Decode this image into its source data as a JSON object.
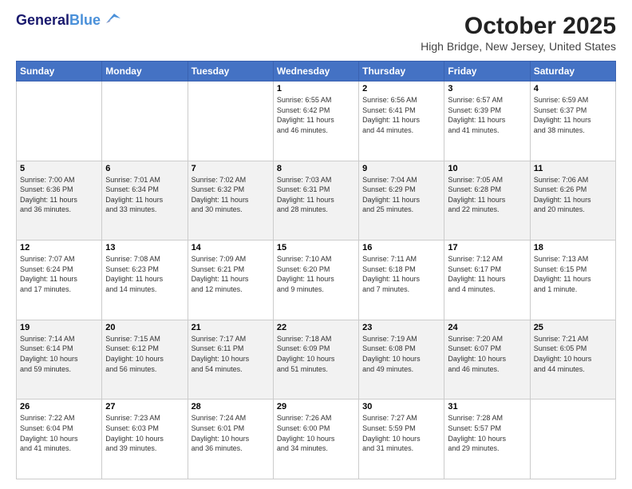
{
  "logo": {
    "line1": "General",
    "line2": "Blue"
  },
  "title": "October 2025",
  "subtitle": "High Bridge, New Jersey, United States",
  "days_of_week": [
    "Sunday",
    "Monday",
    "Tuesday",
    "Wednesday",
    "Thursday",
    "Friday",
    "Saturday"
  ],
  "weeks": [
    [
      {
        "day": "",
        "info": ""
      },
      {
        "day": "",
        "info": ""
      },
      {
        "day": "",
        "info": ""
      },
      {
        "day": "1",
        "info": "Sunrise: 6:55 AM\nSunset: 6:42 PM\nDaylight: 11 hours\nand 46 minutes."
      },
      {
        "day": "2",
        "info": "Sunrise: 6:56 AM\nSunset: 6:41 PM\nDaylight: 11 hours\nand 44 minutes."
      },
      {
        "day": "3",
        "info": "Sunrise: 6:57 AM\nSunset: 6:39 PM\nDaylight: 11 hours\nand 41 minutes."
      },
      {
        "day": "4",
        "info": "Sunrise: 6:59 AM\nSunset: 6:37 PM\nDaylight: 11 hours\nand 38 minutes."
      }
    ],
    [
      {
        "day": "5",
        "info": "Sunrise: 7:00 AM\nSunset: 6:36 PM\nDaylight: 11 hours\nand 36 minutes."
      },
      {
        "day": "6",
        "info": "Sunrise: 7:01 AM\nSunset: 6:34 PM\nDaylight: 11 hours\nand 33 minutes."
      },
      {
        "day": "7",
        "info": "Sunrise: 7:02 AM\nSunset: 6:32 PM\nDaylight: 11 hours\nand 30 minutes."
      },
      {
        "day": "8",
        "info": "Sunrise: 7:03 AM\nSunset: 6:31 PM\nDaylight: 11 hours\nand 28 minutes."
      },
      {
        "day": "9",
        "info": "Sunrise: 7:04 AM\nSunset: 6:29 PM\nDaylight: 11 hours\nand 25 minutes."
      },
      {
        "day": "10",
        "info": "Sunrise: 7:05 AM\nSunset: 6:28 PM\nDaylight: 11 hours\nand 22 minutes."
      },
      {
        "day": "11",
        "info": "Sunrise: 7:06 AM\nSunset: 6:26 PM\nDaylight: 11 hours\nand 20 minutes."
      }
    ],
    [
      {
        "day": "12",
        "info": "Sunrise: 7:07 AM\nSunset: 6:24 PM\nDaylight: 11 hours\nand 17 minutes."
      },
      {
        "day": "13",
        "info": "Sunrise: 7:08 AM\nSunset: 6:23 PM\nDaylight: 11 hours\nand 14 minutes."
      },
      {
        "day": "14",
        "info": "Sunrise: 7:09 AM\nSunset: 6:21 PM\nDaylight: 11 hours\nand 12 minutes."
      },
      {
        "day": "15",
        "info": "Sunrise: 7:10 AM\nSunset: 6:20 PM\nDaylight: 11 hours\nand 9 minutes."
      },
      {
        "day": "16",
        "info": "Sunrise: 7:11 AM\nSunset: 6:18 PM\nDaylight: 11 hours\nand 7 minutes."
      },
      {
        "day": "17",
        "info": "Sunrise: 7:12 AM\nSunset: 6:17 PM\nDaylight: 11 hours\nand 4 minutes."
      },
      {
        "day": "18",
        "info": "Sunrise: 7:13 AM\nSunset: 6:15 PM\nDaylight: 11 hours\nand 1 minute."
      }
    ],
    [
      {
        "day": "19",
        "info": "Sunrise: 7:14 AM\nSunset: 6:14 PM\nDaylight: 10 hours\nand 59 minutes."
      },
      {
        "day": "20",
        "info": "Sunrise: 7:15 AM\nSunset: 6:12 PM\nDaylight: 10 hours\nand 56 minutes."
      },
      {
        "day": "21",
        "info": "Sunrise: 7:17 AM\nSunset: 6:11 PM\nDaylight: 10 hours\nand 54 minutes."
      },
      {
        "day": "22",
        "info": "Sunrise: 7:18 AM\nSunset: 6:09 PM\nDaylight: 10 hours\nand 51 minutes."
      },
      {
        "day": "23",
        "info": "Sunrise: 7:19 AM\nSunset: 6:08 PM\nDaylight: 10 hours\nand 49 minutes."
      },
      {
        "day": "24",
        "info": "Sunrise: 7:20 AM\nSunset: 6:07 PM\nDaylight: 10 hours\nand 46 minutes."
      },
      {
        "day": "25",
        "info": "Sunrise: 7:21 AM\nSunset: 6:05 PM\nDaylight: 10 hours\nand 44 minutes."
      }
    ],
    [
      {
        "day": "26",
        "info": "Sunrise: 7:22 AM\nSunset: 6:04 PM\nDaylight: 10 hours\nand 41 minutes."
      },
      {
        "day": "27",
        "info": "Sunrise: 7:23 AM\nSunset: 6:03 PM\nDaylight: 10 hours\nand 39 minutes."
      },
      {
        "day": "28",
        "info": "Sunrise: 7:24 AM\nSunset: 6:01 PM\nDaylight: 10 hours\nand 36 minutes."
      },
      {
        "day": "29",
        "info": "Sunrise: 7:26 AM\nSunset: 6:00 PM\nDaylight: 10 hours\nand 34 minutes."
      },
      {
        "day": "30",
        "info": "Sunrise: 7:27 AM\nSunset: 5:59 PM\nDaylight: 10 hours\nand 31 minutes."
      },
      {
        "day": "31",
        "info": "Sunrise: 7:28 AM\nSunset: 5:57 PM\nDaylight: 10 hours\nand 29 minutes."
      },
      {
        "day": "",
        "info": ""
      }
    ]
  ]
}
